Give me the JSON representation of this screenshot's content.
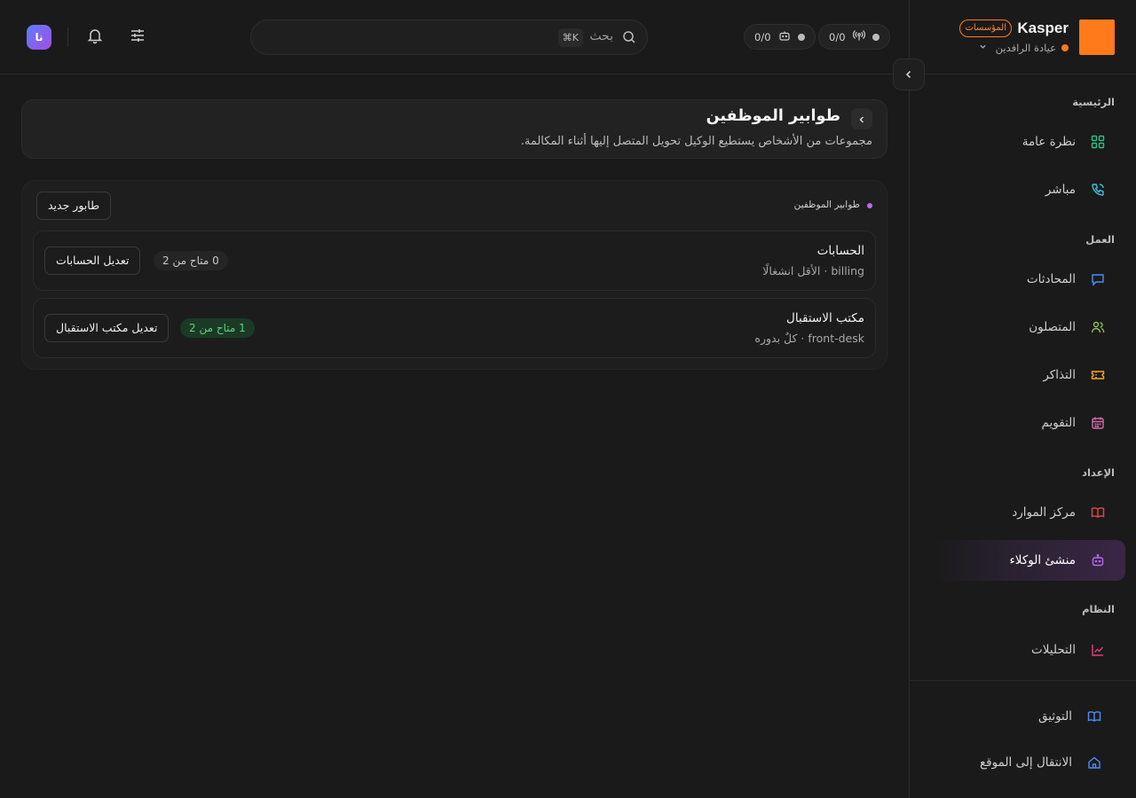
{
  "brand": {
    "name": "Kasper",
    "badge": "المؤسسات",
    "workspace": "عيادة الرافدين",
    "logo_color": "#ff7a1a"
  },
  "topbar": {
    "status_calls": "0/0",
    "status_agents": "0/0",
    "search_placeholder": "بحث",
    "search_shortcut": "⌘K",
    "avatar_initials": "نا"
  },
  "sidebar": {
    "sections": [
      {
        "title": "الرئيسية",
        "items": [
          {
            "label": "نظرة عامة",
            "icon": "grid-icon",
            "color": "#2fbf8a"
          },
          {
            "label": "مباشر",
            "icon": "phone-icon",
            "color": "#38c6e0"
          }
        ]
      },
      {
        "title": "العمل",
        "items": [
          {
            "label": "المحادثات",
            "icon": "chat-icon",
            "color": "#4d8cf5"
          },
          {
            "label": "المتصلون",
            "icon": "users-icon",
            "color": "#8bc34a"
          },
          {
            "label": "التذاكر",
            "icon": "ticket-icon",
            "color": "#f5a623"
          },
          {
            "label": "التقويم",
            "icon": "calendar-icon",
            "color": "#d36ba8"
          }
        ]
      },
      {
        "title": "الإعداد",
        "items": [
          {
            "label": "مركز الموارد",
            "icon": "book-icon",
            "color": "#e5484d"
          },
          {
            "label": "منشئ الوكلاء",
            "icon": "bot-icon",
            "color": "#b76cf0",
            "active": true
          }
        ]
      },
      {
        "title": "النظام",
        "items": [
          {
            "label": "التحليلات",
            "icon": "chart-icon",
            "color": "#e0407a"
          }
        ]
      }
    ],
    "footer": [
      {
        "label": "التوثيق",
        "icon": "docs-icon",
        "color": "#4d8cf5"
      },
      {
        "label": "الانتقال إلى الموقع",
        "icon": "home-icon",
        "color": "#4d8cf5"
      }
    ]
  },
  "page": {
    "title": "طوابير الموظفين",
    "description": "مجموعات من الأشخاص يستطيع الوكيل تحويل المتصل إليها أثناء المكالمة."
  },
  "queues_panel": {
    "label": "طوابير الموظفين",
    "new_button": "طابور جديد",
    "rows": [
      {
        "name": "الحسابات",
        "meta": "billing · الأقل انشغالًا",
        "availability": "0 متاح من 2",
        "edit_label": "تعديل الحسابات",
        "status": "grey"
      },
      {
        "name": "مكتب الاستقبال",
        "meta": "front-desk · كلٌ بدوره",
        "availability": "1 متاح من 2",
        "edit_label": "تعديل مكتب الاستقبال",
        "status": "green"
      }
    ]
  }
}
